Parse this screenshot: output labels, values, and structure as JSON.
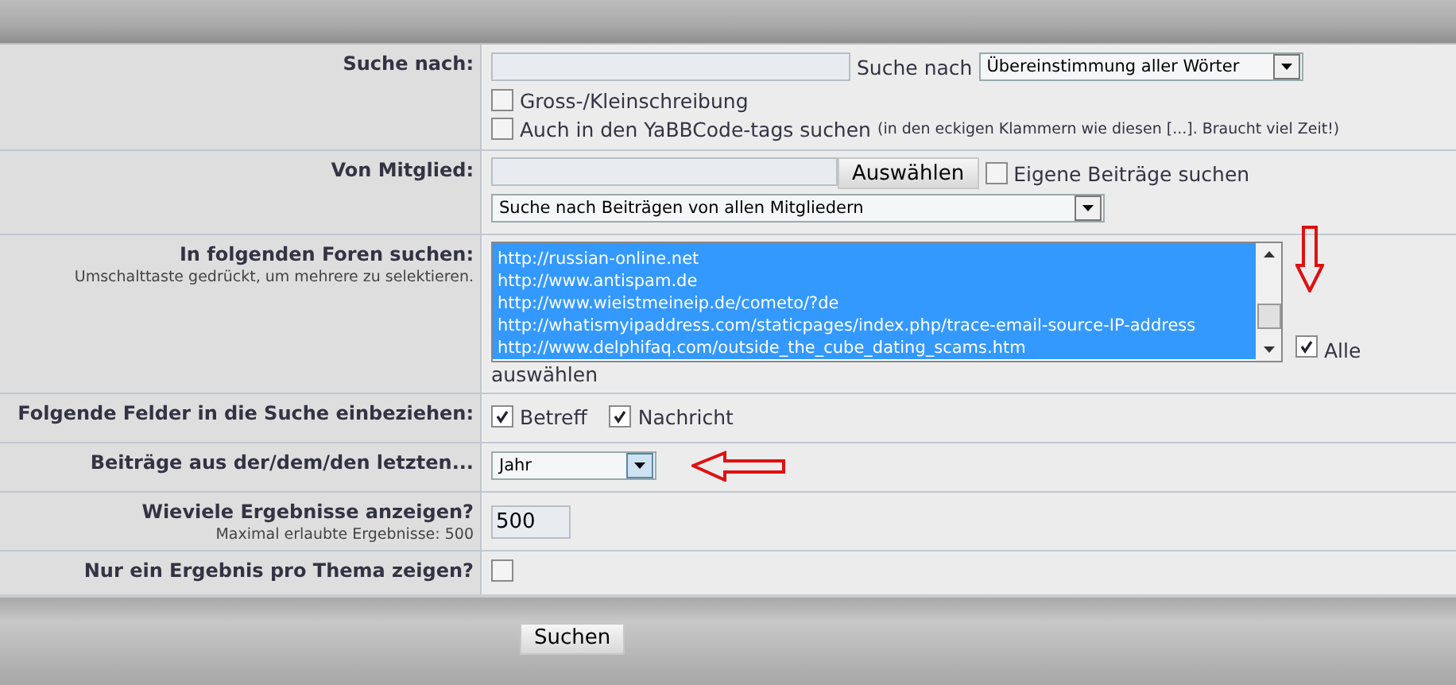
{
  "rows": [
    {
      "kind": "query",
      "label": "Suche nach:",
      "mode_label": "Suche nach",
      "mode": "Übereinstimmung aller Wörter",
      "options": [
        {
          "label": "Gross-/Kleinschreibung",
          "checked": false
        },
        {
          "label": "Auch in den YaBBCode-tags suchen",
          "note": "(in den eckigen Klammern wie diesen [...]. Braucht viel Zeit!)",
          "checked": false
        }
      ]
    },
    {
      "kind": "member",
      "label": "Von Mitglied:",
      "button": "Auswählen",
      "own": {
        "label": "Eigene Beiträge suchen",
        "checked": false
      },
      "scope": "Suche nach Beiträgen von allen Mitgliedern"
    },
    {
      "kind": "forums",
      "label": "In folgenden Foren suchen:",
      "hint": "Umschalttaste gedrückt, um mehrere zu selektieren.",
      "items": [
        {
          "label": "http://russian-online.net",
          "selected": true
        },
        {
          "label": "http://www.antispam.de",
          "selected": true
        },
        {
          "label": "http://www.wieistmeineip.de/cometo/?de",
          "selected": true
        },
        {
          "label": "http://whatismyipaddress.com/staticpages/index.php/trace-email-source-IP-address",
          "selected": true
        },
        {
          "label": "http://www.delphifaq.com/outside_the_cube_dating_scams.htm",
          "selected": true
        }
      ],
      "all": {
        "label": "Alle",
        "label_continued": "auswählen",
        "checked": true
      }
    },
    {
      "kind": "fields",
      "label": "Folgende Felder in die Suche einbeziehen:",
      "fields": [
        {
          "label": "Betreff",
          "checked": true
        },
        {
          "label": "Nachricht",
          "checked": true
        }
      ]
    },
    {
      "kind": "period",
      "label": "Beiträge aus der/dem/den letzten...",
      "value": "Jahr"
    },
    {
      "kind": "count",
      "label": "Wieviele Ergebnisse anzeigen?",
      "hint": "Maximal erlaubte Ergebnisse: 500",
      "value": "500"
    },
    {
      "kind": "single",
      "label": "Nur ein Ergebnis pro Thema zeigen?",
      "checked": false
    }
  ],
  "submit": "Suchen"
}
